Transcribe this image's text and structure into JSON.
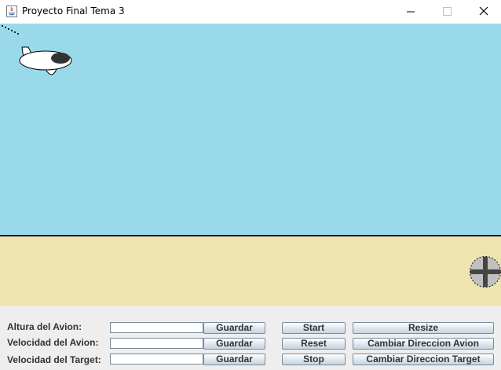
{
  "window": {
    "title": "Proyecto Final Tema 3",
    "controls": {
      "minimize": "—",
      "maximize": "☐",
      "close": "✕"
    }
  },
  "scene": {
    "sky_color": "#99d9ea",
    "ground_color": "#efe4b0",
    "airplane": "airplane-icon",
    "target": "crosshair-target-icon"
  },
  "panel": {
    "rows": [
      {
        "label": "Altura del Avion:",
        "value": "",
        "guardar": "Guardar"
      },
      {
        "label": "Velocidad del Avion:",
        "value": "",
        "guardar": "Guardar"
      },
      {
        "label": "Velocidad del Target:",
        "value": "",
        "guardar": "Guardar"
      }
    ],
    "buttons": {
      "start": "Start",
      "reset": "Reset",
      "stop": "Stop",
      "resize": "Resize",
      "cambiar_avion": "Cambiar Direccion Avion",
      "cambiar_target": "Cambiar Direccion Target"
    }
  }
}
